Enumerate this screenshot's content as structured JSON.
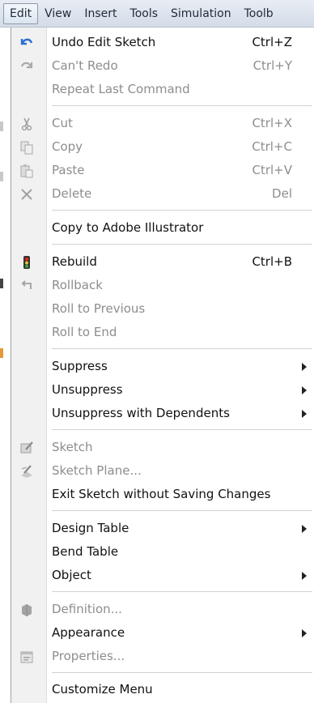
{
  "menubar": {
    "items": [
      "Edit",
      "View",
      "Insert",
      "Tools",
      "Simulation",
      "Toolb"
    ],
    "active_index": 0
  },
  "menu": {
    "items": [
      {
        "label": "Undo Edit Sketch",
        "shortcut": "Ctrl+Z",
        "enabled": true,
        "icon": "undo-icon"
      },
      {
        "label": "Can't Redo",
        "shortcut": "Ctrl+Y",
        "enabled": false,
        "icon": "redo-icon"
      },
      {
        "label": "Repeat Last Command",
        "shortcut": "",
        "enabled": false,
        "icon": ""
      },
      {
        "label": "Cut",
        "shortcut": "Ctrl+X",
        "enabled": false,
        "icon": "scissors-icon"
      },
      {
        "label": "Copy",
        "shortcut": "Ctrl+C",
        "enabled": false,
        "icon": "copy-icon"
      },
      {
        "label": "Paste",
        "shortcut": "Ctrl+V",
        "enabled": false,
        "icon": "paste-icon"
      },
      {
        "label": "Delete",
        "shortcut": "Del",
        "enabled": false,
        "icon": "delete-x-icon"
      },
      {
        "label": "Copy to Adobe Illustrator",
        "shortcut": "",
        "enabled": true,
        "icon": ""
      },
      {
        "label": "Rebuild",
        "shortcut": "Ctrl+B",
        "enabled": true,
        "icon": "traffic-light-icon"
      },
      {
        "label": "Rollback",
        "shortcut": "",
        "enabled": false,
        "icon": "rollback-arrow-icon"
      },
      {
        "label": "Roll to Previous",
        "shortcut": "",
        "enabled": false,
        "icon": ""
      },
      {
        "label": "Roll to End",
        "shortcut": "",
        "enabled": false,
        "icon": ""
      },
      {
        "label": "Suppress",
        "shortcut": "",
        "enabled": true,
        "icon": "",
        "submenu": true
      },
      {
        "label": "Unsuppress",
        "shortcut": "",
        "enabled": true,
        "icon": "",
        "submenu": true
      },
      {
        "label": "Unsuppress with Dependents",
        "shortcut": "",
        "enabled": true,
        "icon": "",
        "submenu": true
      },
      {
        "label": "Sketch",
        "shortcut": "",
        "enabled": false,
        "icon": "sketch-icon"
      },
      {
        "label": "Sketch Plane...",
        "shortcut": "",
        "enabled": false,
        "icon": "sketch-plane-icon"
      },
      {
        "label": "Exit Sketch without Saving Changes",
        "shortcut": "",
        "enabled": true,
        "icon": ""
      },
      {
        "label": "Design Table",
        "shortcut": "",
        "enabled": true,
        "icon": "",
        "submenu": true
      },
      {
        "label": "Bend Table",
        "shortcut": "",
        "enabled": true,
        "icon": ""
      },
      {
        "label": "Object",
        "shortcut": "",
        "enabled": true,
        "icon": "",
        "submenu": true
      },
      {
        "label": "Definition...",
        "shortcut": "",
        "enabled": false,
        "icon": "definition-icon"
      },
      {
        "label": "Appearance",
        "shortcut": "",
        "enabled": true,
        "icon": "",
        "submenu": true
      },
      {
        "label": "Properties...",
        "shortcut": "",
        "enabled": false,
        "icon": "properties-icon"
      },
      {
        "label": "Customize Menu",
        "shortcut": "",
        "enabled": true,
        "icon": ""
      }
    ]
  }
}
